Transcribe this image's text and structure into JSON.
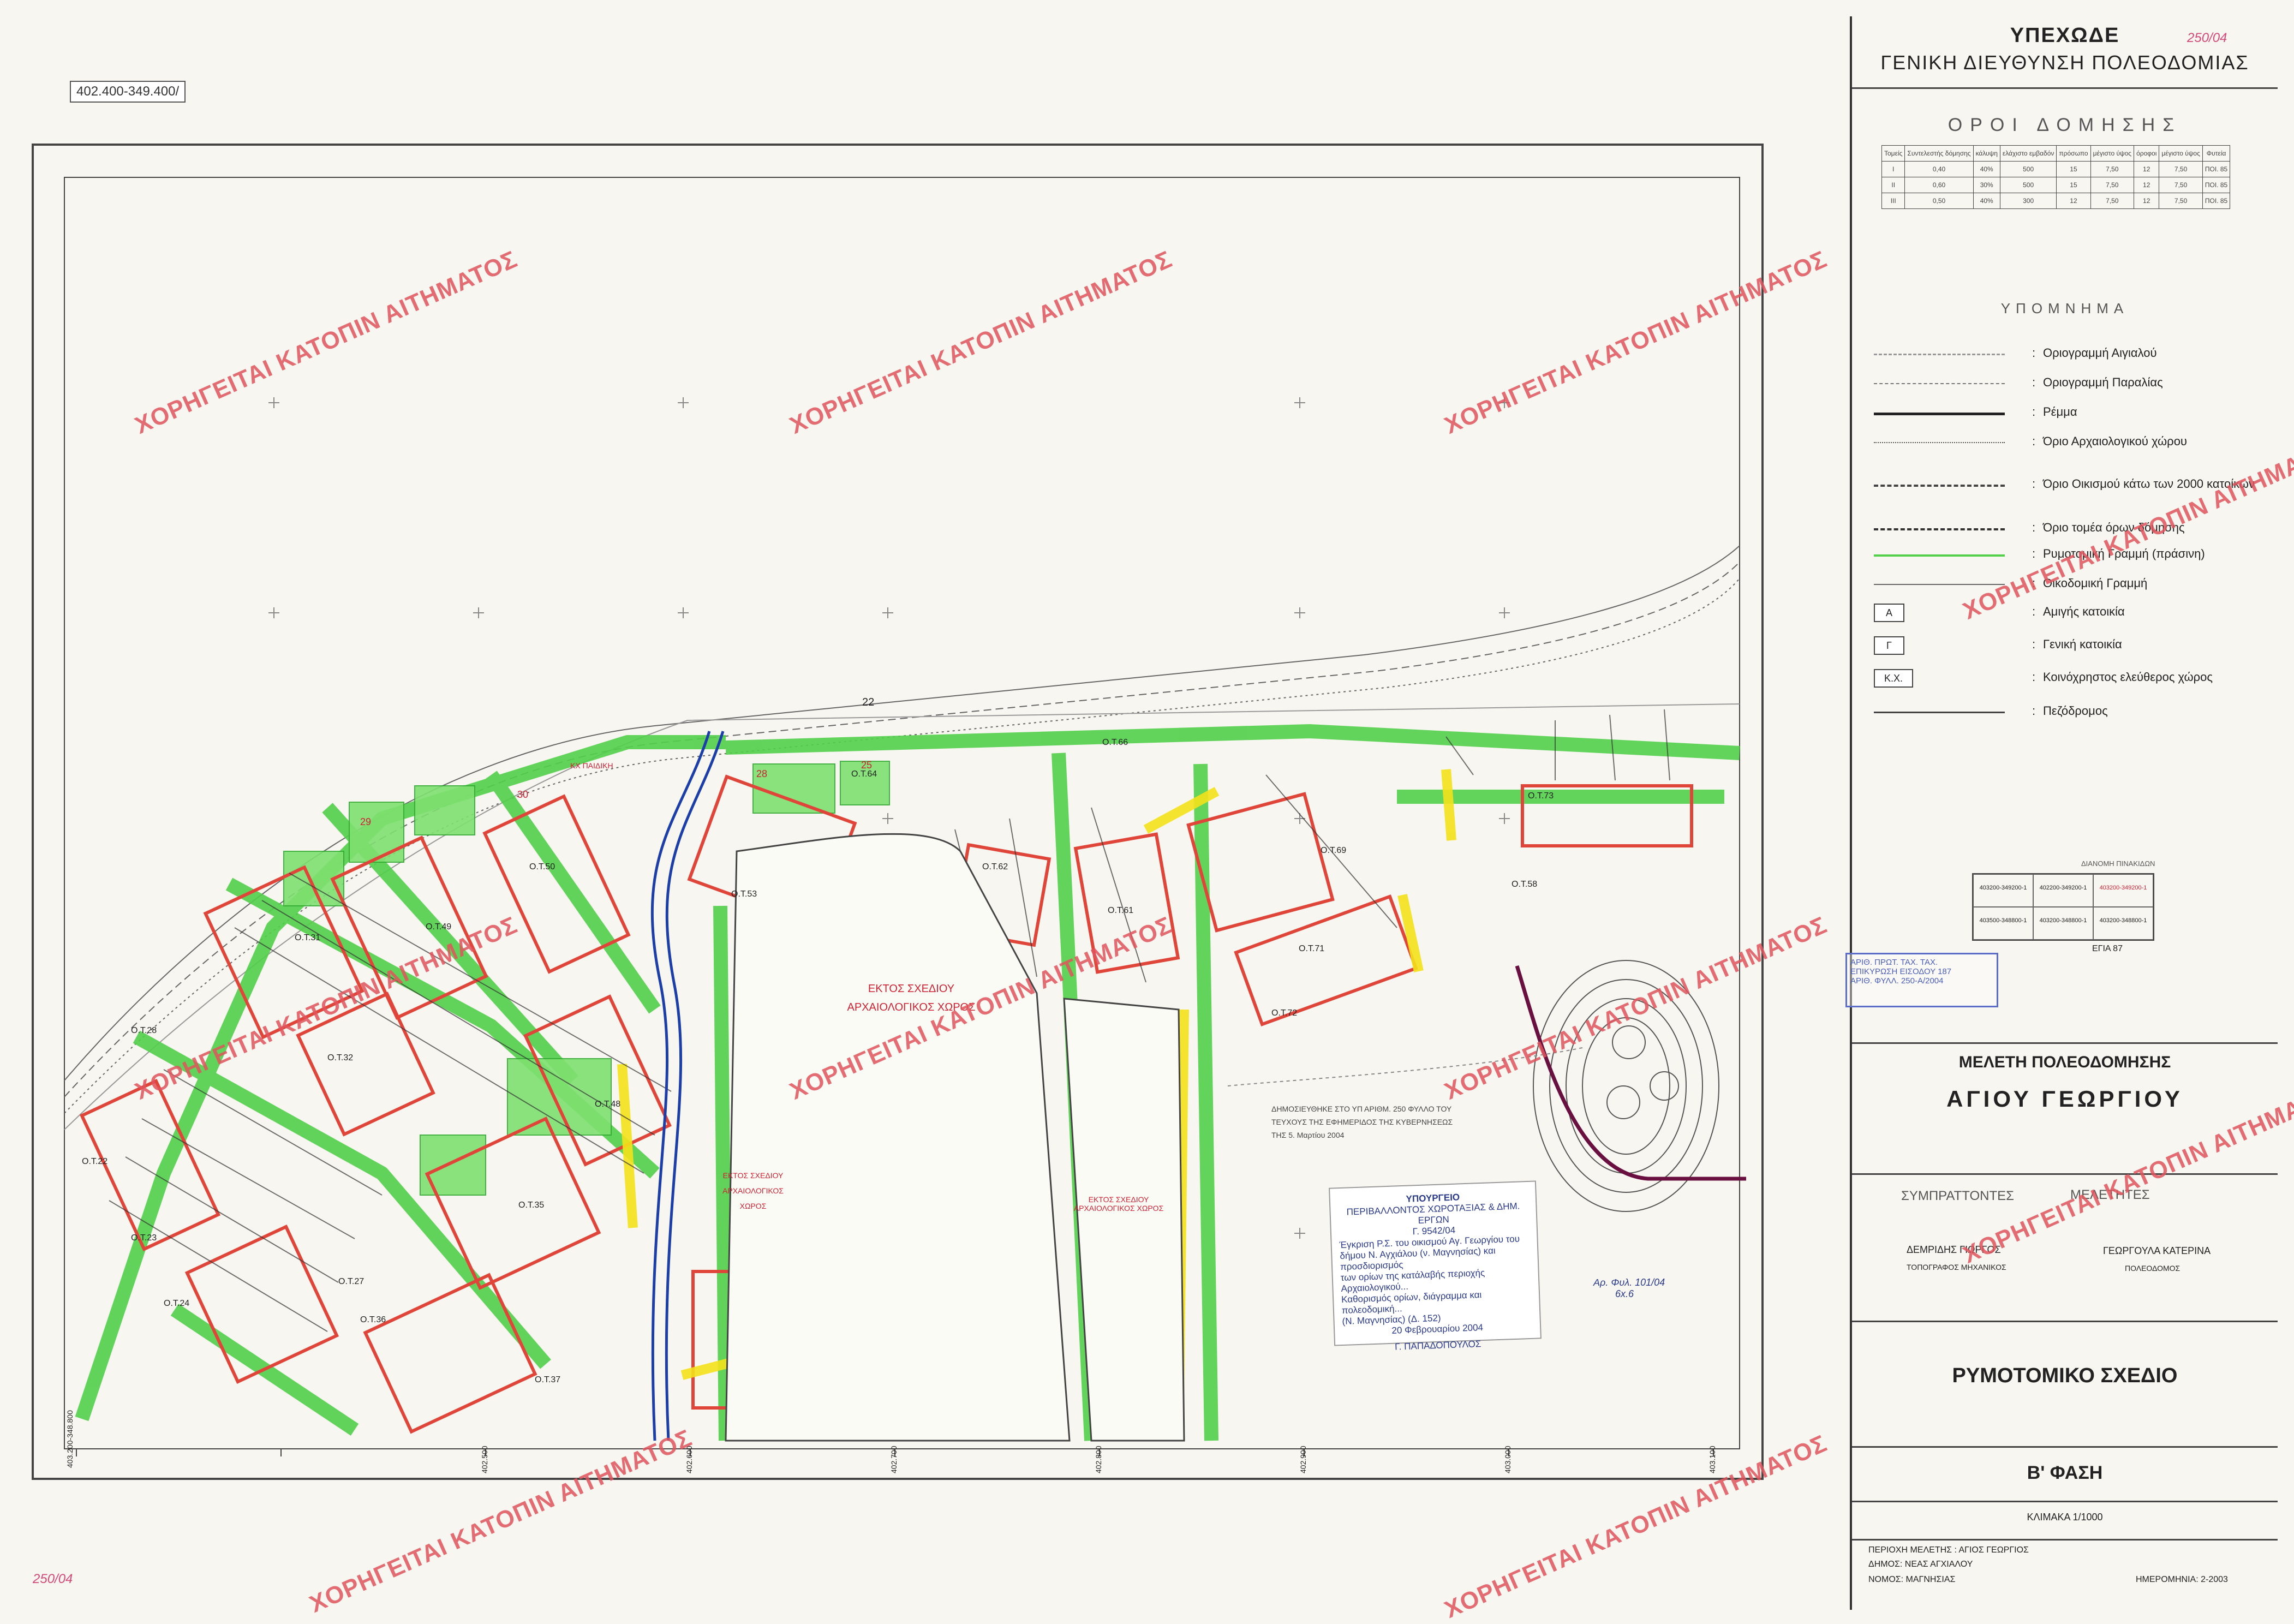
{
  "sheet": {
    "coord_label": "402.400-349.400/",
    "corner_number_top": "250/04",
    "corner_number_bottom": "250/04"
  },
  "header": {
    "ministry": "ΥΠΕΧΩΔΕ",
    "directorate": "ΓΕΝΙΚΗ ΔΙΕΥΘΥΝΣΗ ΠΟΛΕΟΔΟΜΙΑΣ"
  },
  "building_terms": {
    "title": "ΟΡΟΙ ΔΟΜΗΣΗΣ",
    "headers": [
      "Τομείς",
      "Συντελεστής δόμησης",
      "κάλυψη",
      "ελάχιστο εμβαδόν",
      "πρόσωπο",
      "μέγιστο ύψος",
      "όροφοι",
      "μέγιστο ύψος",
      "Φυτεία"
    ],
    "rows": [
      [
        "I",
        "0,40",
        "40%",
        "500",
        "15",
        "7,50",
        "12",
        "7,50",
        "ΠΟΙ. 85"
      ],
      [
        "II",
        "0,60",
        "30%",
        "500",
        "15",
        "7,50",
        "12",
        "7,50",
        "ΠΟΙ. 85"
      ],
      [
        "III",
        "0,50",
        "40%",
        "300",
        "12",
        "7,50",
        "12",
        "7,50",
        "ΠΟΙ. 85"
      ]
    ]
  },
  "legend": {
    "title": "ΥΠΟΜΝΗΜΑ",
    "items": [
      {
        "symbol": "dash-dot",
        "label": "Οριογραμμή Αιγιαλού"
      },
      {
        "symbol": "dashed",
        "label": "Οριογραμμή Παραλίας"
      },
      {
        "symbol": "thick",
        "label": "Ρέμμα"
      },
      {
        "symbol": "dotted",
        "label": "Όριο Αρχαιολογικού χώρου"
      },
      {
        "symbol": "dash-dot-dot",
        "label": "Όριο Οικισμού κάτω των 2000 κατοίκων"
      },
      {
        "symbol": "dash-cross",
        "label": "Όριο τομέα όρων δόμησης"
      },
      {
        "symbol": "green",
        "label": "Ρυμοτομική Γραμμή (πράσινη)"
      },
      {
        "symbol": "thin",
        "label": "Οικοδομική Γραμμή"
      },
      {
        "symbol": "A",
        "label": "Αμιγής κατοικία"
      },
      {
        "symbol": "Γ",
        "label": "Γενική κατοικία"
      },
      {
        "symbol": "Κ.Χ.",
        "label": "Κοινόχρηστος ελεύθερος χώρος"
      },
      {
        "symbol": "ped",
        "label": "Πεζόδρομος"
      }
    ]
  },
  "sheet_index": {
    "title": "ΔΙΑΝΟΜΗ ΠΙΝΑΚΙΔΩΝ",
    "cells": [
      "403200-349200-1",
      "402200-349200-1",
      "403200-349200-1",
      "403500-348800-1",
      "403200-348800-1",
      "403200-348800-1"
    ],
    "caption": "ΕΓΙΑ 87"
  },
  "blue_stamp": {
    "lines": [
      "ΑΡΙΘ. ΠΡΩΤ. ΤΑΧ. ΤΑΧ.",
      "ΕΠΙΚΥΡΩΣΗ ΕΙΣΟΔΟΥ 187",
      "ΑΡΙΘ. ΦΥΛΛ. 250-Α/2004"
    ]
  },
  "study": {
    "title": "ΜΕΛΕΤΗ ΠΟΛΕΟΔΟΜΗΣΗΣ",
    "place": "ΑΓΙΟΥ ΓΕΩΡΓΙΟΥ",
    "contributors_label": "ΣΥΜΠΡΑΤΤΟΝΤΕΣ",
    "designers_label": "ΜΕΛΕΤΗΤΕΣ",
    "designer1_name": "ΔΕΜΡΙΔΗΣ ΓΙΩΡΓΟΣ",
    "designer1_role": "ΤΟΠΟΓΡΑΦΟΣ ΜΗΧΑΝΙΚΟΣ",
    "designer2_name": "ΓΕΩΡΓΟΥΛΑ ΚΑΤΕΡΙΝΑ",
    "designer2_role": "ΠΟΛΕΟΔΟΜΟΣ",
    "plan_type": "ΡΥΜΟΤΟΜΙΚΟ ΣΧΕΔΙΟ",
    "phase": "Β' ΦΑΣΗ",
    "scale": "ΚΛΙΜΑΚΑ 1/1000",
    "area": "ΠΕΡΙΟΧΗ ΜΕΛΕΤΗΣ : ΑΓΙΟΣ ΓΕΩΡΓΙΟΣ",
    "municipality": "ΔΗΜΟΣ: ΝΕΑΣ ΑΓΧΙΑΛΟΥ",
    "prefecture": "ΝΟΜΟΣ: ΜΑΓΝΗΣΙΑΣ",
    "date": "ΗΜΕΡΟΜΗΝΙΑ: 2-2003"
  },
  "map_labels": {
    "archaeo_main_1": "ΕΚΤΟΣ ΣΧΕΔΙΟΥ",
    "archaeo_main_2": "ΑΡΧΑΙΟΛΟΓΙΚΟΣ ΧΩΡΟΣ",
    "archaeo_small_1": "ΕΚΤΟΣ ΣΧΕΔΙΟΥ",
    "archaeo_small_2": "ΑΡΧΑΙΟΛΟΓΙΚΟΣ ΧΩΡΟΣ",
    "archaeo_south": "ΕΚΤΟΣ ΣΧΕΔΙΟΥ ΑΡΧΑΙΟΛΟΓΙΚΟΣ ΧΩΡΟΣ",
    "blocks": [
      "Ο.Τ.31",
      "Ο.Τ.32",
      "Ο.Τ.49",
      "Ο.Τ.50",
      "Ο.Τ.53",
      "Ο.Τ.62",
      "Ο.Τ.61",
      "Ο.Τ.69",
      "Ο.Τ.71",
      "Ο.Τ.72",
      "Ο.Τ.73",
      "Ο.Τ.58",
      "Ο.Τ.35",
      "Ο.Τ.36",
      "Ο.Τ.37",
      "Ο.Τ.23",
      "Ο.Τ.24",
      "Ο.Τ.28",
      "Ο.Τ.22",
      "Ο.Τ.27",
      "Ο.Τ.48",
      "Ο.Τ.64",
      "Ο.Τ.66"
    ],
    "kx_label": "ΚΧ ΠΑΙΔΙΚΗ",
    "sea_coords_x": [
      "403.200-348.800",
      "402.600",
      "402.700",
      "402.800",
      "402.900",
      "403.000",
      "403.100",
      "402.500"
    ],
    "road_22": "22",
    "green_nums": [
      "28",
      "29",
      "30",
      "25"
    ]
  },
  "approval_stamp": {
    "title": "ΥΠΟΥΡΓΕΙΟ",
    "lines": [
      "ΠΕΡΙΒΑΛΛΟΝΤΟΣ ΧΩΡΟΤΑΞΙΑΣ & ΔΗΜ. ΕΡΓΩΝ",
      "Γ. 9542/04",
      "Έγκριση Ρ.Σ. του οικισμού Αγ. Γεωργίου του",
      "δήμου Ν. Αγχιάλου (ν. Μαγνησίας) και προσδιορισμός",
      "των ορίων της κατάλαβής περιοχής Αρχαιολογικού...",
      "Καθορισμός ορίων, διάγραμμα και πολεοδομική...",
      "(Ν. Μαγνησίας) (Δ. 152)",
      "20 Φεβρουαρίου 2004"
    ],
    "signer": "Γ. ΠΑΠΑΔΟΠΟΥΛΟΣ"
  },
  "gazette_note": {
    "line1": "ΔΗΜΟΣΙΕΥΘΗΚΕ ΣΤΟ ΥΠ ΑΡΙΘΜ. 250 ΦΥΛΛΟ ΤΟΥ",
    "line2": "ΤΕΥΧΟΥΣ ΤΗΣ ΕΦΗΜΕΡΙΔΟΣ ΤΗΣ ΚΥΒΕΡΝΗΣΕΩΣ",
    "line3": "ΤΗΣ 5. Μαρτίου 2004"
  },
  "handwritten_note": {
    "line1": "Αρ. Φυλ. 101/04",
    "line2": "6x.6"
  },
  "watermark_text": "ΧΟΡΗΓΕΙΤΑΙ ΚΑΤΟΠΙΝ ΑΙΤΗΜΑΤΟΣ",
  "colors": {
    "street_green": "#52d04a",
    "block_red": "#e0453a",
    "yellow": "#f4e21a",
    "river_blue": "#1c3ea8",
    "watermark": "#e0555d",
    "purple_line": "#6a1040"
  }
}
